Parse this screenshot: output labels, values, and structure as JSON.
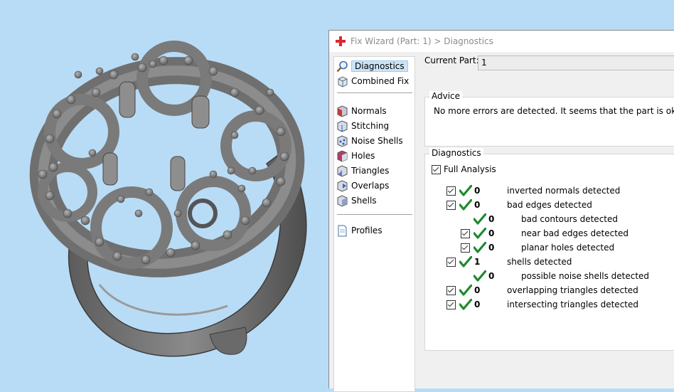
{
  "window": {
    "title": "Fix Wizard (Part: 1) > Diagnostics"
  },
  "nav": {
    "top_items": [
      {
        "label": "Diagnostics",
        "icon": "magnifier-icon",
        "selected": true
      },
      {
        "label": "Combined Fix",
        "icon": "cube-icon"
      }
    ],
    "fix_items": [
      {
        "label": "Normals",
        "icon": "normals-cube-icon"
      },
      {
        "label": "Stitching",
        "icon": "stitching-cube-icon"
      },
      {
        "label": "Noise Shells",
        "icon": "noise-shells-icon"
      },
      {
        "label": "Holes",
        "icon": "holes-cube-icon"
      },
      {
        "label": "Triangles",
        "icon": "triangles-cube-icon"
      },
      {
        "label": "Overlaps",
        "icon": "overlaps-cube-icon"
      },
      {
        "label": "Shells",
        "icon": "shells-cube-icon"
      }
    ],
    "bottom_items": [
      {
        "label": "Profiles",
        "icon": "document-icon"
      }
    ]
  },
  "current_part": {
    "label": "Current Part:",
    "value": "1"
  },
  "advice": {
    "title": "Advice",
    "text": "No more errors are detected. It seems that the part is ok."
  },
  "diagnostics": {
    "title": "Diagnostics",
    "full_analysis_label": "Full Analysis",
    "rows": [
      {
        "count": "0",
        "label": "inverted normals detected",
        "level": 0,
        "checkbox": true
      },
      {
        "count": "0",
        "label": "bad edges detected",
        "level": 0,
        "checkbox": true
      },
      {
        "count": "0",
        "label": "bad contours detected",
        "level": 1,
        "checkbox": false
      },
      {
        "count": "0",
        "label": "near bad edges detected",
        "level": 1,
        "checkbox": true
      },
      {
        "count": "0",
        "label": "planar holes detected",
        "level": 1,
        "checkbox": true
      },
      {
        "count": "1",
        "label": "shells detected",
        "level": 0,
        "checkbox": true
      },
      {
        "count": "0",
        "label": "possible noise shells detected",
        "level": 1,
        "checkbox": false
      },
      {
        "count": "0",
        "label": "overlapping triangles detected",
        "level": 0,
        "checkbox": true
      },
      {
        "count": "0",
        "label": "intersecting triangles detected",
        "level": 0,
        "checkbox": true
      }
    ]
  },
  "colors": {
    "viewport_bg": "#b9dcf6",
    "tick_green": "#1e8a2e",
    "app_icon_red": "#d9282f",
    "selection": "#cce4f7"
  }
}
